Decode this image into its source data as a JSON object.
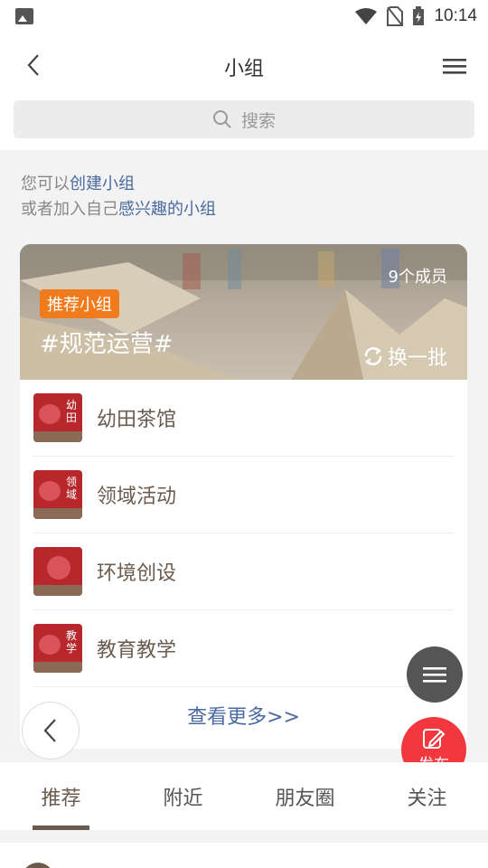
{
  "status": {
    "time": "10:14"
  },
  "header": {
    "title": "小组"
  },
  "search": {
    "placeholder": "搜索"
  },
  "intro": {
    "line1_prefix": "您可以",
    "line1_link": "创建小组",
    "line2_prefix": "或者加入自己",
    "line2_link": "感兴趣的小组"
  },
  "card": {
    "members": "9个成员",
    "tag": "推荐小组",
    "topic": "#规范运营#",
    "refresh": "换一批",
    "groups": [
      {
        "name": "幼田茶馆",
        "thumb": "幼田"
      },
      {
        "name": "领域活动",
        "thumb": "领域"
      },
      {
        "name": "环境创设",
        "thumb": ""
      },
      {
        "name": "教育教学",
        "thumb": "教学"
      }
    ],
    "more": "查看更多>>"
  },
  "fab": {
    "post_label": "发布"
  },
  "tabs": [
    {
      "label": "推荐"
    },
    {
      "label": "附近"
    },
    {
      "label": "朋友圈"
    },
    {
      "label": "关注"
    }
  ],
  "colors": {
    "accent": "#6b5b4e",
    "link": "#4a6aa0",
    "tag": "#f07b1c",
    "post": "#f2373f"
  }
}
